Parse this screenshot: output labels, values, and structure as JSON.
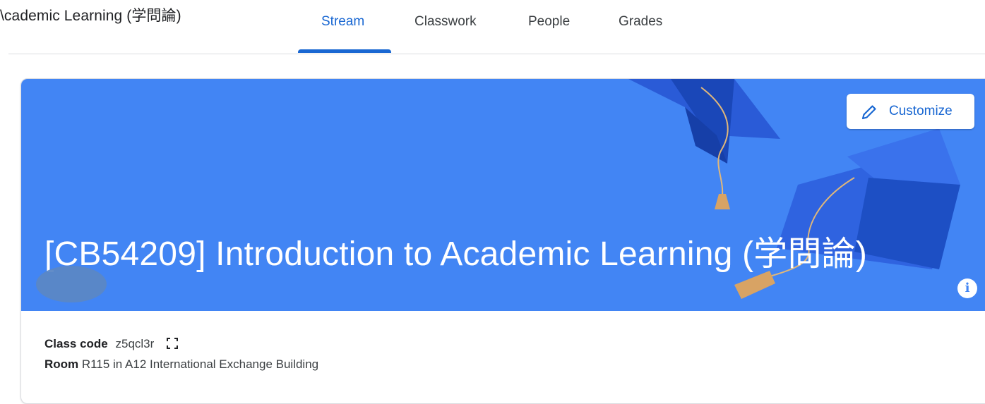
{
  "header": {
    "title": "\\cademic Learning (学問論)",
    "tabs": [
      {
        "label": "Stream",
        "active": true
      },
      {
        "label": "Classwork",
        "active": false
      },
      {
        "label": "People",
        "active": false
      },
      {
        "label": "Grades",
        "active": false
      }
    ]
  },
  "banner": {
    "course_title": "[CB54209] Introduction to Academic Learning (学問論)",
    "customize_label": "Customize",
    "background_color": "#4285f4"
  },
  "details": {
    "class_code_label": "Class code",
    "class_code_value": "z5qcl3r",
    "room_label": "Room",
    "room_value": "R115 in A12 International Exchange Building"
  },
  "colors": {
    "accent": "#1967d2",
    "banner": "#4285f4"
  }
}
